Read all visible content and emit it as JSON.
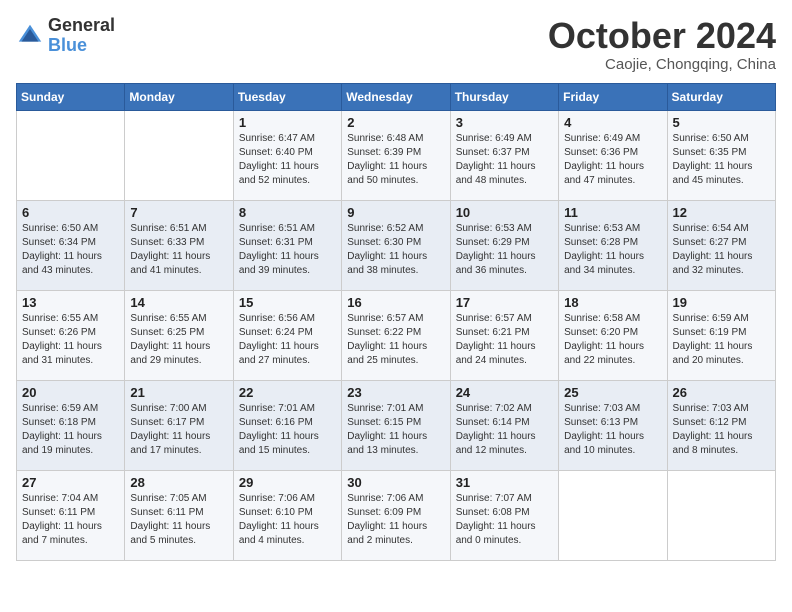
{
  "header": {
    "logo_general": "General",
    "logo_blue": "Blue",
    "month_title": "October 2024",
    "location": "Caojie, Chongqing, China"
  },
  "weekdays": [
    "Sunday",
    "Monday",
    "Tuesday",
    "Wednesday",
    "Thursday",
    "Friday",
    "Saturday"
  ],
  "weeks": [
    [
      {
        "day": "",
        "info": ""
      },
      {
        "day": "",
        "info": ""
      },
      {
        "day": "1",
        "info": "Sunrise: 6:47 AM\nSunset: 6:40 PM\nDaylight: 11 hours and 52 minutes."
      },
      {
        "day": "2",
        "info": "Sunrise: 6:48 AM\nSunset: 6:39 PM\nDaylight: 11 hours and 50 minutes."
      },
      {
        "day": "3",
        "info": "Sunrise: 6:49 AM\nSunset: 6:37 PM\nDaylight: 11 hours and 48 minutes."
      },
      {
        "day": "4",
        "info": "Sunrise: 6:49 AM\nSunset: 6:36 PM\nDaylight: 11 hours and 47 minutes."
      },
      {
        "day": "5",
        "info": "Sunrise: 6:50 AM\nSunset: 6:35 PM\nDaylight: 11 hours and 45 minutes."
      }
    ],
    [
      {
        "day": "6",
        "info": "Sunrise: 6:50 AM\nSunset: 6:34 PM\nDaylight: 11 hours and 43 minutes."
      },
      {
        "day": "7",
        "info": "Sunrise: 6:51 AM\nSunset: 6:33 PM\nDaylight: 11 hours and 41 minutes."
      },
      {
        "day": "8",
        "info": "Sunrise: 6:51 AM\nSunset: 6:31 PM\nDaylight: 11 hours and 39 minutes."
      },
      {
        "day": "9",
        "info": "Sunrise: 6:52 AM\nSunset: 6:30 PM\nDaylight: 11 hours and 38 minutes."
      },
      {
        "day": "10",
        "info": "Sunrise: 6:53 AM\nSunset: 6:29 PM\nDaylight: 11 hours and 36 minutes."
      },
      {
        "day": "11",
        "info": "Sunrise: 6:53 AM\nSunset: 6:28 PM\nDaylight: 11 hours and 34 minutes."
      },
      {
        "day": "12",
        "info": "Sunrise: 6:54 AM\nSunset: 6:27 PM\nDaylight: 11 hours and 32 minutes."
      }
    ],
    [
      {
        "day": "13",
        "info": "Sunrise: 6:55 AM\nSunset: 6:26 PM\nDaylight: 11 hours and 31 minutes."
      },
      {
        "day": "14",
        "info": "Sunrise: 6:55 AM\nSunset: 6:25 PM\nDaylight: 11 hours and 29 minutes."
      },
      {
        "day": "15",
        "info": "Sunrise: 6:56 AM\nSunset: 6:24 PM\nDaylight: 11 hours and 27 minutes."
      },
      {
        "day": "16",
        "info": "Sunrise: 6:57 AM\nSunset: 6:22 PM\nDaylight: 11 hours and 25 minutes."
      },
      {
        "day": "17",
        "info": "Sunrise: 6:57 AM\nSunset: 6:21 PM\nDaylight: 11 hours and 24 minutes."
      },
      {
        "day": "18",
        "info": "Sunrise: 6:58 AM\nSunset: 6:20 PM\nDaylight: 11 hours and 22 minutes."
      },
      {
        "day": "19",
        "info": "Sunrise: 6:59 AM\nSunset: 6:19 PM\nDaylight: 11 hours and 20 minutes."
      }
    ],
    [
      {
        "day": "20",
        "info": "Sunrise: 6:59 AM\nSunset: 6:18 PM\nDaylight: 11 hours and 19 minutes."
      },
      {
        "day": "21",
        "info": "Sunrise: 7:00 AM\nSunset: 6:17 PM\nDaylight: 11 hours and 17 minutes."
      },
      {
        "day": "22",
        "info": "Sunrise: 7:01 AM\nSunset: 6:16 PM\nDaylight: 11 hours and 15 minutes."
      },
      {
        "day": "23",
        "info": "Sunrise: 7:01 AM\nSunset: 6:15 PM\nDaylight: 11 hours and 13 minutes."
      },
      {
        "day": "24",
        "info": "Sunrise: 7:02 AM\nSunset: 6:14 PM\nDaylight: 11 hours and 12 minutes."
      },
      {
        "day": "25",
        "info": "Sunrise: 7:03 AM\nSunset: 6:13 PM\nDaylight: 11 hours and 10 minutes."
      },
      {
        "day": "26",
        "info": "Sunrise: 7:03 AM\nSunset: 6:12 PM\nDaylight: 11 hours and 8 minutes."
      }
    ],
    [
      {
        "day": "27",
        "info": "Sunrise: 7:04 AM\nSunset: 6:11 PM\nDaylight: 11 hours and 7 minutes."
      },
      {
        "day": "28",
        "info": "Sunrise: 7:05 AM\nSunset: 6:11 PM\nDaylight: 11 hours and 5 minutes."
      },
      {
        "day": "29",
        "info": "Sunrise: 7:06 AM\nSunset: 6:10 PM\nDaylight: 11 hours and 4 minutes."
      },
      {
        "day": "30",
        "info": "Sunrise: 7:06 AM\nSunset: 6:09 PM\nDaylight: 11 hours and 2 minutes."
      },
      {
        "day": "31",
        "info": "Sunrise: 7:07 AM\nSunset: 6:08 PM\nDaylight: 11 hours and 0 minutes."
      },
      {
        "day": "",
        "info": ""
      },
      {
        "day": "",
        "info": ""
      }
    ]
  ]
}
